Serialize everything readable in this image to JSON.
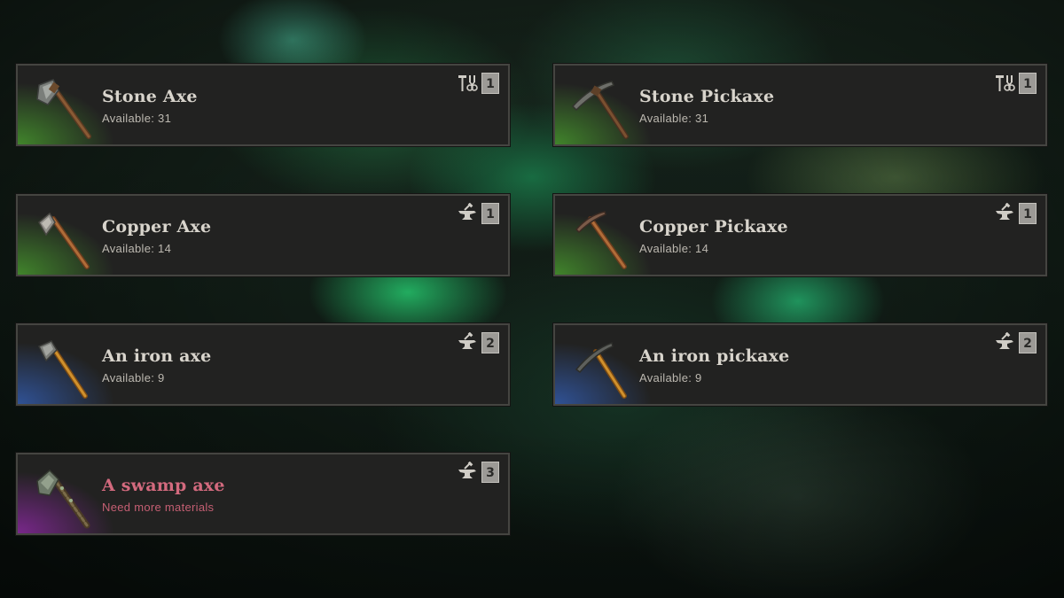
{
  "recipes": [
    {
      "name": "Stone Axe",
      "status": "Available: 31",
      "station": "workbench-tools-icon",
      "tier": "1",
      "tool": "axe",
      "rarity_color": "#46962d",
      "locked": false
    },
    {
      "name": "Stone Pickaxe",
      "status": "Available: 31",
      "station": "workbench-tools-icon",
      "tier": "1",
      "tool": "pickaxe",
      "rarity_color": "#46962d",
      "locked": false
    },
    {
      "name": "Copper Axe",
      "status": "Available: 14",
      "station": "anvil-icon",
      "tier": "1",
      "tool": "axe",
      "rarity_color": "#46962d",
      "locked": false
    },
    {
      "name": "Copper Pickaxe",
      "status": "Available: 14",
      "station": "anvil-icon",
      "tier": "1",
      "tool": "pickaxe",
      "rarity_color": "#46962d",
      "locked": false
    },
    {
      "name": "An iron axe",
      "status": "Available: 9",
      "station": "anvil-icon",
      "tier": "2",
      "tool": "axe",
      "rarity_color": "#325aaa",
      "locked": false
    },
    {
      "name": "An iron pickaxe",
      "status": "Available: 9",
      "station": "anvil-icon",
      "tier": "2",
      "tool": "pickaxe",
      "rarity_color": "#325aaa",
      "locked": false
    },
    {
      "name": "A swamp axe",
      "status": "Need more materials",
      "station": "anvil-icon",
      "tier": "3",
      "tool": "axe",
      "rarity_color": "#822896",
      "locked": true
    }
  ],
  "colors": {
    "card_bg": "#222221",
    "card_border": "#454541",
    "title_text": "#d8d4cc",
    "locked_text": "#d36a7e",
    "tier_badge": "#9c9a96"
  }
}
